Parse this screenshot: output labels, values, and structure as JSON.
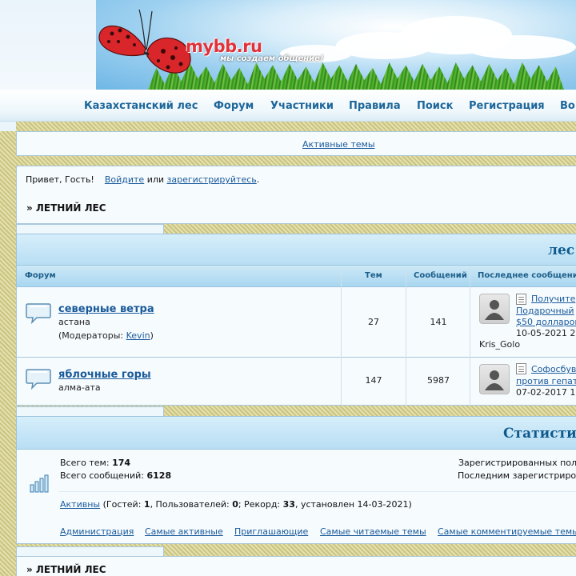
{
  "header": {
    "logo_text": "mybb.ru",
    "slogan": "мы создаем общение!"
  },
  "nav": {
    "items": [
      "Казахстанский лес",
      "Форум",
      "Участники",
      "Правила",
      "Поиск",
      "Регистрация",
      "Во"
    ]
  },
  "active_topics_link": "Активные темы",
  "welcome": {
    "greeting": "Привет, Гость!",
    "login": "Войдите",
    "or": "или",
    "register": "зарегистрируйтесь",
    "period": "."
  },
  "breadcrumb_top": "» ЛЕТНИЙ ЛЕС",
  "category": {
    "title": "лес",
    "columns": {
      "forum": "Форум",
      "topics": "Тем",
      "posts": "Сообщений",
      "last_post": "Последнее сообщени"
    },
    "forums": [
      {
        "name": "северные ветра",
        "description": "астана",
        "moderators_prefix": "(Модераторы:",
        "moderator": "Kevin",
        "moderators_suffix": ")",
        "topics": "27",
        "posts": "141",
        "last_post_lines": [
          "Получите",
          "Подарочный",
          "$50 долларов"
        ],
        "last_post_date": "10-05-2021 2",
        "last_post_author": "Kris_Golo"
      },
      {
        "name": "яблочные горы",
        "description": "алма-ата",
        "topics": "147",
        "posts": "5987",
        "last_post_lines": [
          "Софосбув",
          "против гепат"
        ],
        "last_post_date": "07-02-2017 1"
      }
    ]
  },
  "stats": {
    "title": "Статисти",
    "total_topics_label": "Всего тем:",
    "total_topics": "174",
    "total_posts_label": "Всего сообщений:",
    "total_posts": "6128",
    "registered_users_label": "Зарегистрированных пол",
    "last_registered_label": "Последним зарегистриро",
    "online_link": "Активны",
    "guests_prefix": "(Гостей:",
    "guests": "1",
    "users_prefix": ", Пользователей:",
    "users": "0",
    "record_prefix": "; Рекорд:",
    "record": "33",
    "record_suffix": ", установлен 14-03-2021)",
    "links": [
      "Администрация",
      "Самые активные",
      "Приглашающие",
      "Самые читаемые темы",
      "Самые комментируемые темы"
    ]
  },
  "breadcrumb_bottom": "» ЛЕТНИЙ ЛЕС"
}
